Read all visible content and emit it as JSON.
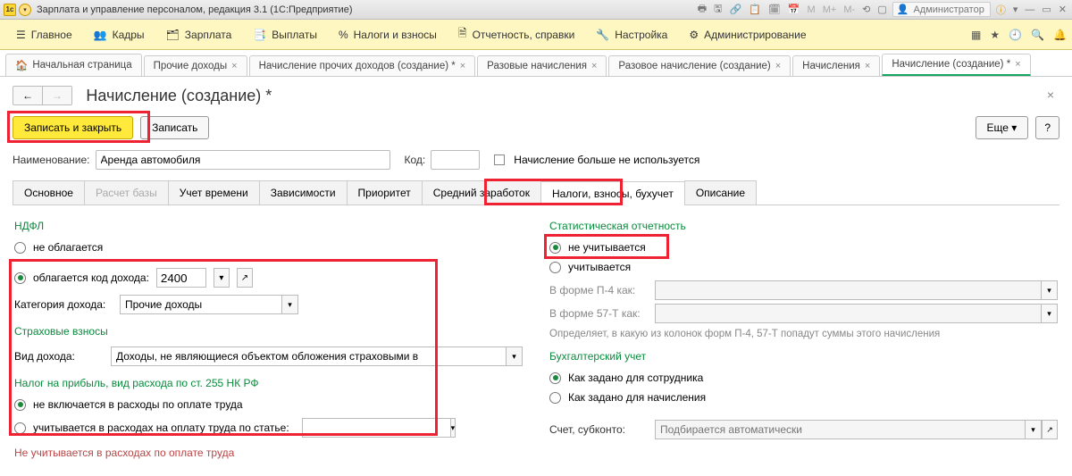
{
  "titlebar": {
    "app": "Зарплата и управление персоналом, редакция 3.1  (1С:Предприятие)",
    "user": "Администратор",
    "m_labels": [
      "M",
      "M+",
      "M-"
    ]
  },
  "menu": {
    "items": [
      {
        "label": "Главное"
      },
      {
        "label": "Кадры"
      },
      {
        "label": "Зарплата"
      },
      {
        "label": "Выплаты"
      },
      {
        "label": "Налоги и взносы"
      },
      {
        "label": "Отчетность, справки"
      },
      {
        "label": "Настройка"
      },
      {
        "label": "Администрирование"
      }
    ]
  },
  "tabs": [
    {
      "label": "Начальная страница",
      "closable": false,
      "home": true
    },
    {
      "label": "Прочие доходы",
      "closable": true
    },
    {
      "label": "Начисление прочих доходов (создание) *",
      "closable": true
    },
    {
      "label": "Разовые начисления",
      "closable": true
    },
    {
      "label": "Разовое начисление (создание)",
      "closable": true
    },
    {
      "label": "Начисления",
      "closable": true
    },
    {
      "label": "Начисление (создание) *",
      "closable": true,
      "active": true
    }
  ],
  "page": {
    "title": "Начисление (создание) *",
    "save_close": "Записать и закрыть",
    "save": "Записать",
    "more": "Еще",
    "q": "?",
    "name_label": "Наименование:",
    "name_value": "Аренда автомобиля",
    "code_label": "Код:",
    "code_value": "",
    "not_used": "Начисление больше не используется"
  },
  "inner_tabs": [
    {
      "label": "Основное"
    },
    {
      "label": "Расчет базы",
      "disabled": true
    },
    {
      "label": "Учет времени"
    },
    {
      "label": "Зависимости"
    },
    {
      "label": "Приоритет"
    },
    {
      "label": "Средний заработок"
    },
    {
      "label": "Налоги, взносы, бухучет",
      "active": true
    },
    {
      "label": "Описание"
    }
  ],
  "left": {
    "ndfl": "НДФЛ",
    "r1": "не облагается",
    "r2_pre": "облагается   код дохода:",
    "code": "2400",
    "cat_label": "Категория дохода:",
    "cat_value": "Прочие доходы",
    "insurance": "Страховые взносы",
    "income_type_label": "Вид дохода:",
    "income_type_value": "Доходы, не являющиеся объектом обложения страховыми в",
    "profit_tax": "Налог на прибыль, вид расхода по ст. 255 НК РФ",
    "pt_r1": "не включается в расходы по оплате труда",
    "pt_r2": "учитывается в расходах на оплату труда по статье:",
    "note": "Не учитывается в расходах по оплате труда"
  },
  "right": {
    "stat": "Статистическая отчетность",
    "sr1": "не учитывается",
    "sr2": "учитывается",
    "p4_label": "В форме П-4 как:",
    "p57_label": "В форме 57-Т как:",
    "help": "Определяет, в какую из колонок форм П-4, 57-Т попадут суммы этого начисления",
    "acc": "Бухгалтерский учет",
    "ar1": "Как задано для сотрудника",
    "ar2": "Как задано для начисления",
    "acc_label": "Счет, субконто:",
    "acc_ph": "Подбирается автоматически"
  }
}
